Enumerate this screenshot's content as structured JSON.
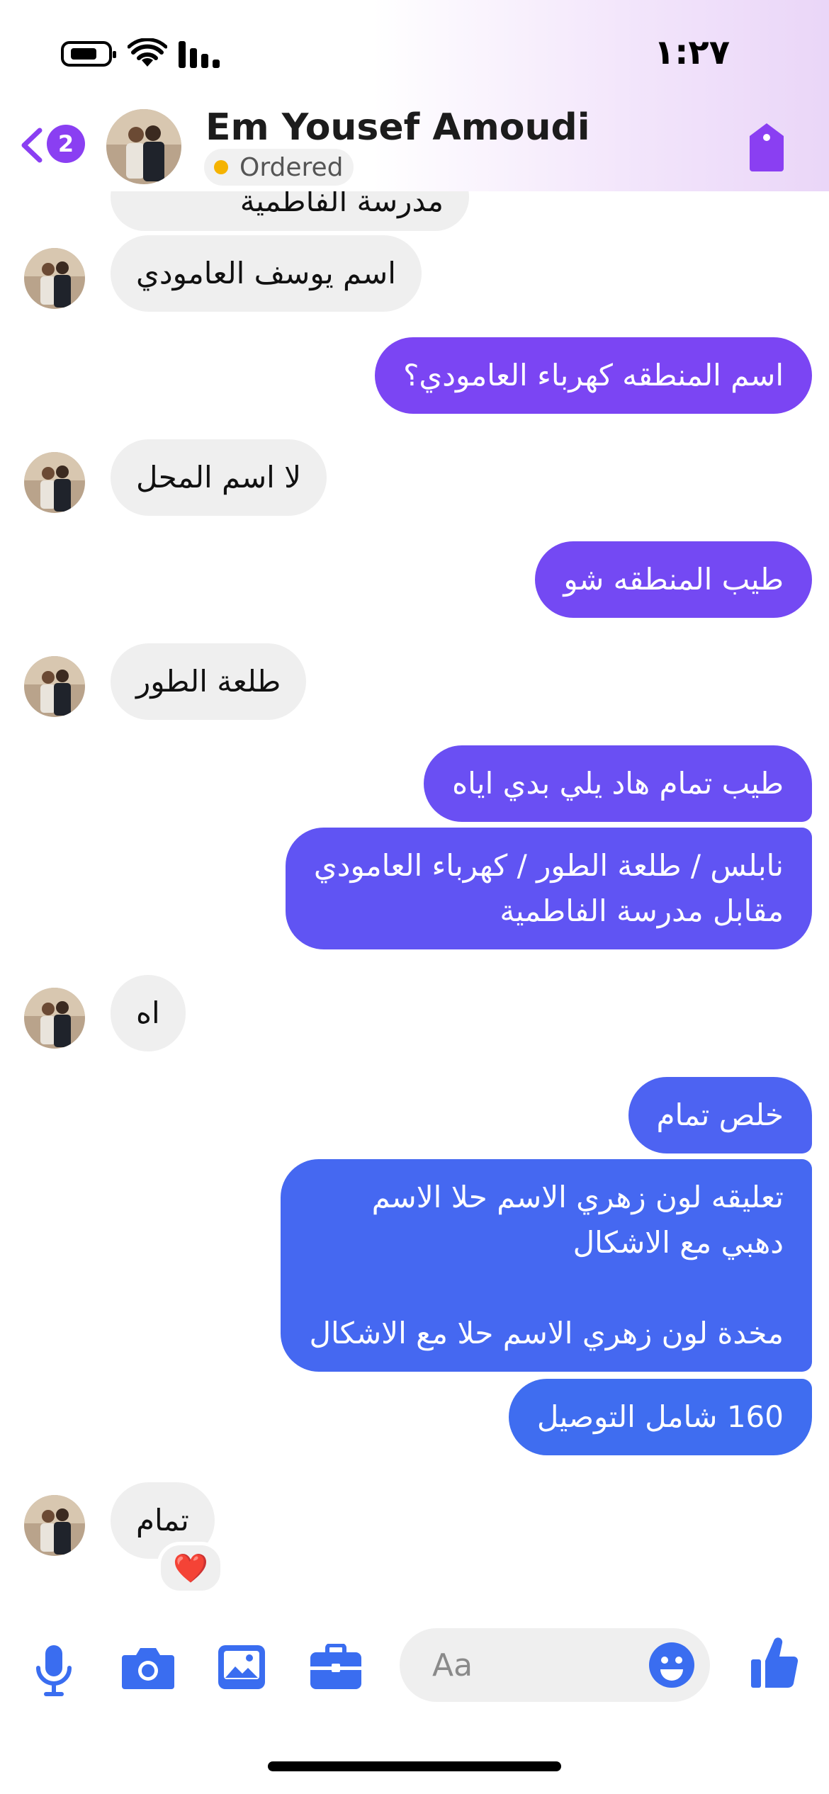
{
  "status_bar": {
    "time": "١:٢٧"
  },
  "header": {
    "back_badge": "2",
    "contact_name": "Em Yousef Amoudi",
    "order_status": "Ordered"
  },
  "messages": [
    {
      "direction": "in",
      "text": "مدرسة الفاطمية",
      "avatar": false
    },
    {
      "direction": "in",
      "text": "اسم يوسف العامودي",
      "avatar": true
    },
    {
      "direction": "out",
      "text": "اسم المنطقه كهرباء العامودي؟"
    },
    {
      "direction": "in",
      "text": "لا اسم المحل",
      "avatar": true
    },
    {
      "direction": "out",
      "text": "طيب المنطقه شو"
    },
    {
      "direction": "in",
      "text": "طلعة الطور",
      "avatar": true
    },
    {
      "direction": "out",
      "text": "طيب تمام هاد يلي بدي اياه"
    },
    {
      "direction": "out",
      "text": "نابلس / طلعة الطور / كهرباء العامودي\nمقابل مدرسة الفاطمية"
    },
    {
      "direction": "in",
      "text": "اه",
      "avatar": true
    },
    {
      "direction": "out",
      "text": "خلص تمام"
    },
    {
      "direction": "out",
      "text": "تعليقه لون زهري الاسم حلا الاسم\nدهبي مع الاشكال\n\nمخدة لون زهري الاسم حلا مع الاشكال"
    },
    {
      "direction": "out",
      "text": "160 شامل التوصيل"
    },
    {
      "direction": "in",
      "text": "تمام",
      "avatar": true,
      "reaction": "❤️"
    }
  ],
  "composer": {
    "placeholder": "Aa"
  },
  "colors": {
    "accent_purple": "#8a3ff2",
    "bubble_purple": "#7b45f3",
    "bubble_blue": "#3f6df0",
    "icon_blue": "#3a6df0",
    "incoming_bubble": "#efefef"
  },
  "icons": [
    "microphone-icon",
    "camera-icon",
    "gallery-icon",
    "briefcase-icon",
    "emoji-icon",
    "thumbs-up-icon",
    "tag-icon",
    "chevron-left-icon"
  ]
}
